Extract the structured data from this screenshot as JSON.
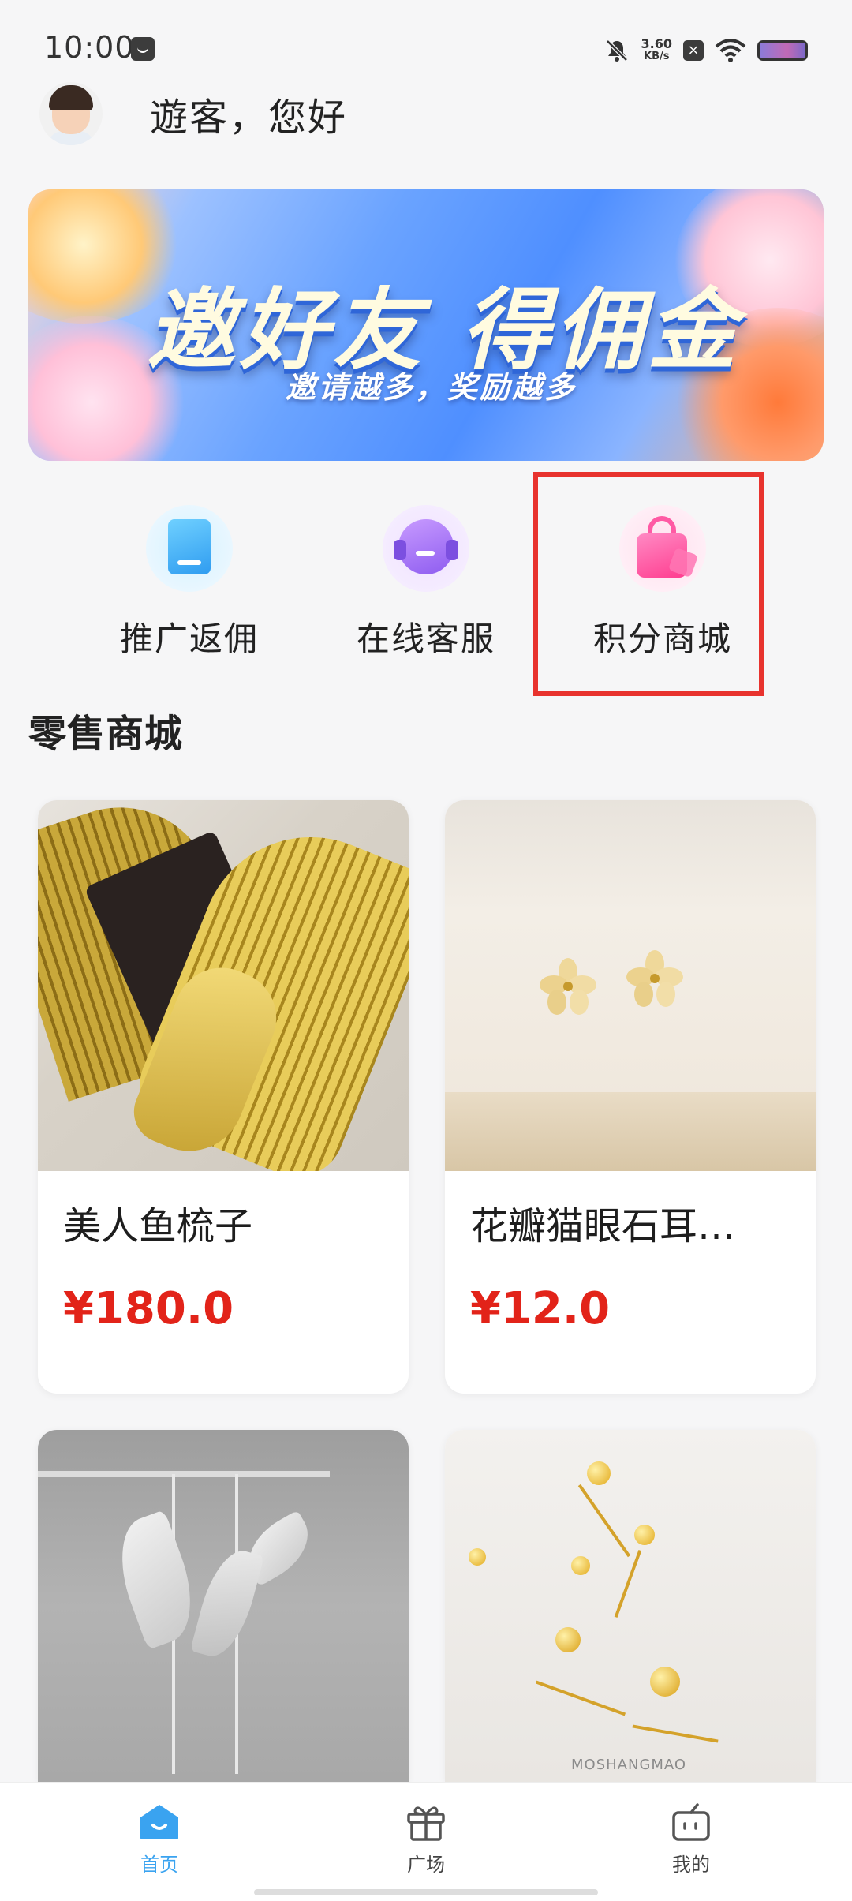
{
  "status_bar": {
    "time": "10:00",
    "net_speed_value": "3.60",
    "net_speed_unit": "KB/s"
  },
  "header": {
    "greeting": "遊客，您好"
  },
  "banner": {
    "title": "邀好友 得佣金",
    "subtitle": "邀请越多，奖励越多"
  },
  "quick_actions": [
    {
      "label": "推广返佣",
      "icon": "book-icon"
    },
    {
      "label": "在线客服",
      "icon": "headset-icon"
    },
    {
      "label": "积分商城",
      "icon": "shopping-bag-icon"
    }
  ],
  "section": {
    "title": "零售商城"
  },
  "products": [
    {
      "name": "美人鱼梳子",
      "price": "¥180.0"
    },
    {
      "name": "花瓣猫眼石耳…",
      "price": "¥12.0"
    },
    {
      "name": "",
      "price": ""
    },
    {
      "name": "",
      "price": ""
    }
  ],
  "product_photo_text": {
    "watermark": "MOSHANGMAO"
  },
  "tabbar": {
    "home": "首页",
    "square": "广场",
    "mine": "我的"
  },
  "colors": {
    "accent": "#3aa3f0",
    "price": "#e22319",
    "highlight": "#e8332e"
  }
}
